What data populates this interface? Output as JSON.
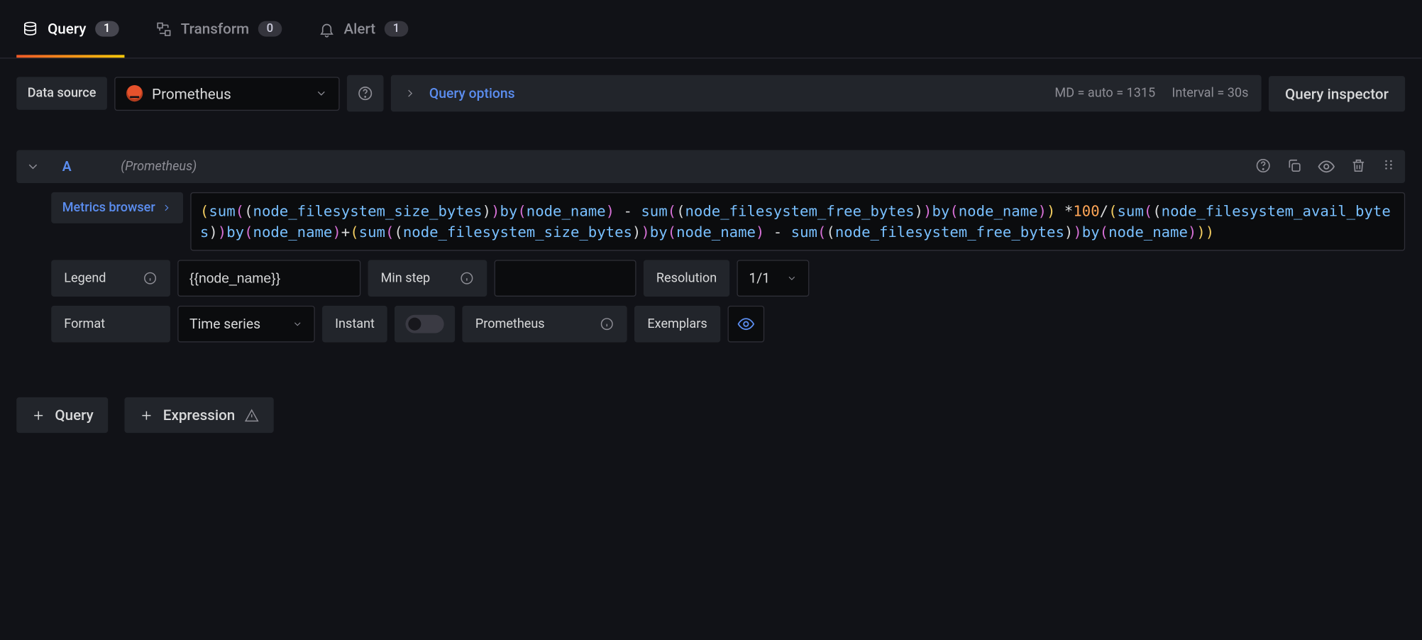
{
  "tabs": {
    "query": {
      "label": "Query",
      "count": "1"
    },
    "transform": {
      "label": "Transform",
      "count": "0"
    },
    "alert": {
      "label": "Alert",
      "count": "1"
    }
  },
  "toolbar": {
    "ds_label": "Data source",
    "ds_value": "Prometheus",
    "query_options": "Query options",
    "md_text": "MD = auto = 1315",
    "interval_text": "Interval = 30s",
    "inspector": "Query inspector"
  },
  "query": {
    "ref": "A",
    "ds": "(Prometheus)",
    "metrics_browser": "Metrics browser",
    "expr_tokens": [
      {
        "t": "(",
        "c": "c-y"
      },
      {
        "t": "sum",
        "c": "c-fn"
      },
      {
        "t": "(",
        "c": "c-m"
      },
      {
        "t": "(",
        "c": "c-p"
      },
      {
        "t": "node_filesystem_size_bytes",
        "c": "c-id"
      },
      {
        "t": ")",
        "c": "c-p"
      },
      {
        "t": ")",
        "c": "c-m"
      },
      {
        "t": "by",
        "c": "c-fn"
      },
      {
        "t": "(",
        "c": "c-m"
      },
      {
        "t": "node_name",
        "c": "c-id"
      },
      {
        "t": ")",
        "c": "c-m"
      },
      {
        "t": " - ",
        "c": "c-p"
      },
      {
        "t": "sum",
        "c": "c-fn"
      },
      {
        "t": "(",
        "c": "c-m"
      },
      {
        "t": "(",
        "c": "c-p"
      },
      {
        "t": "node_filesystem_free_bytes",
        "c": "c-id"
      },
      {
        "t": ")",
        "c": "c-p"
      },
      {
        "t": ")",
        "c": "c-m"
      },
      {
        "t": "by",
        "c": "c-fn"
      },
      {
        "t": "(",
        "c": "c-m"
      },
      {
        "t": "node_name",
        "c": "c-id"
      },
      {
        "t": ")",
        "c": "c-m"
      },
      {
        "t": ")",
        "c": "c-y"
      },
      {
        "t": " ",
        "c": "c-p"
      },
      {
        "t": "*",
        "c": "c-p"
      },
      {
        "t": "100",
        "c": "c-num"
      },
      {
        "t": "/",
        "c": "c-p"
      },
      {
        "t": "(",
        "c": "c-y"
      },
      {
        "t": "sum",
        "c": "c-fn"
      },
      {
        "t": "(",
        "c": "c-m"
      },
      {
        "t": "(",
        "c": "c-p"
      },
      {
        "t": "node_filesystem_avail_bytes",
        "c": "c-id"
      },
      {
        "t": ")",
        "c": "c-p"
      },
      {
        "t": ")",
        "c": "c-m"
      },
      {
        "t": "by",
        "c": "c-fn"
      },
      {
        "t": "(",
        "c": "c-m"
      },
      {
        "t": "node_name",
        "c": "c-id"
      },
      {
        "t": ")",
        "c": "c-m"
      },
      {
        "t": "+",
        "c": "c-p"
      },
      {
        "t": "(",
        "c": "c-y"
      },
      {
        "t": "sum",
        "c": "c-fn"
      },
      {
        "t": "(",
        "c": "c-m"
      },
      {
        "t": "(",
        "c": "c-p"
      },
      {
        "t": "node_filesystem_size_bytes",
        "c": "c-id"
      },
      {
        "t": ")",
        "c": "c-p"
      },
      {
        "t": ")",
        "c": "c-m"
      },
      {
        "t": "by",
        "c": "c-fn"
      },
      {
        "t": "(",
        "c": "c-m"
      },
      {
        "t": "node_name",
        "c": "c-id"
      },
      {
        "t": ")",
        "c": "c-m"
      },
      {
        "t": " - ",
        "c": "c-p"
      },
      {
        "t": "sum",
        "c": "c-fn"
      },
      {
        "t": "(",
        "c": "c-m"
      },
      {
        "t": "(",
        "c": "c-p"
      },
      {
        "t": "node_filesystem_free_bytes",
        "c": "c-id"
      },
      {
        "t": ")",
        "c": "c-p"
      },
      {
        "t": ")",
        "c": "c-m"
      },
      {
        "t": "by",
        "c": "c-fn"
      },
      {
        "t": "(",
        "c": "c-m"
      },
      {
        "t": "node_name",
        "c": "c-id"
      },
      {
        "t": ")",
        "c": "c-m"
      },
      {
        "t": ")",
        "c": "c-y"
      },
      {
        "t": ")",
        "c": "c-y"
      }
    ]
  },
  "opts": {
    "legend_label": "Legend",
    "legend_value": "{{node_name}}",
    "minstep_label": "Min step",
    "minstep_value": "",
    "resolution_label": "Resolution",
    "resolution_value": "1/1",
    "format_label": "Format",
    "format_value": "Time series",
    "instant_label": "Instant",
    "prometheus_label": "Prometheus",
    "exemplars_label": "Exemplars"
  },
  "footer": {
    "query": "Query",
    "expression": "Expression"
  }
}
